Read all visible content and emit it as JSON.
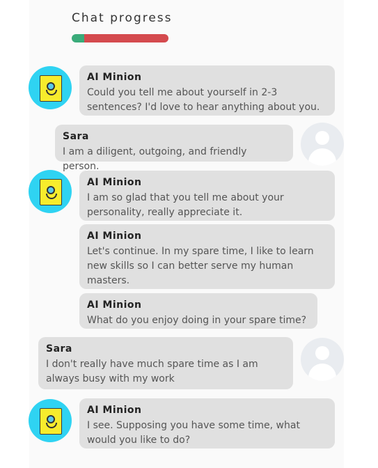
{
  "header": {
    "title": "Chat progress",
    "progress": 0.13,
    "fill_color": "#3aab7a",
    "track_color": "#d44a4e"
  },
  "messages": [
    {
      "sender": "AI Minion",
      "text": "Could you tell me about yourself in 2-3 sentences? I'd love to hear anything about you."
    },
    {
      "sender": "Sara",
      "text": "I am a diligent, outgoing, and friendly person."
    },
    {
      "sender": "AI Minion",
      "text": "I am so glad that you tell me about your personality, really appreciate it."
    },
    {
      "sender": "AI Minion",
      "text": "Let's continue. In my spare time, I like to learn new skills so I can better serve my human masters."
    },
    {
      "sender": "AI Minion",
      "text": "What do you enjoy doing in your spare time?"
    },
    {
      "sender": "Sara",
      "text": "I don't really have much spare time as I am always busy with my work"
    },
    {
      "sender": "AI Minion",
      "text": "I see. Supposing you have some time, what would you like to do?"
    }
  ]
}
